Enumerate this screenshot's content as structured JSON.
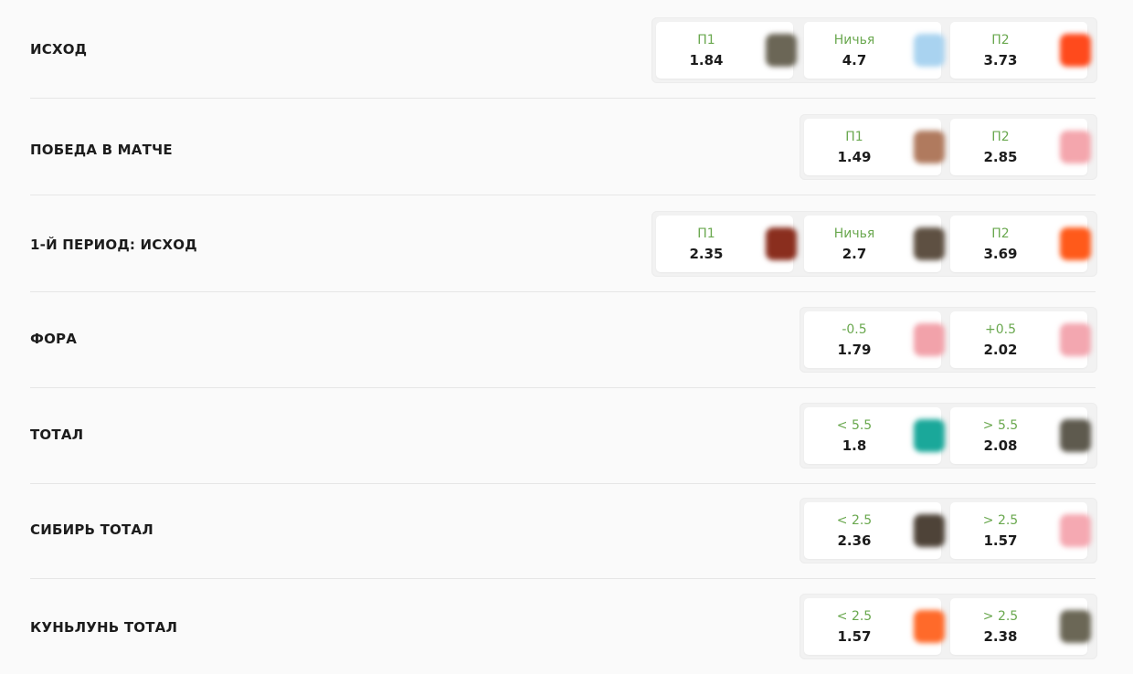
{
  "markets": [
    {
      "name": "ИСХОД",
      "odds": [
        {
          "label": "П1",
          "value": "1.84",
          "thumb_color": "#6b6656"
        },
        {
          "label": "Ничья",
          "value": "4.7",
          "thumb_color": "#a9d3f0"
        },
        {
          "label": "П2",
          "value": "3.73",
          "thumb_color": "#ff4a1c"
        }
      ]
    },
    {
      "name": "ПОБЕДА В МАТЧЕ",
      "odds": [
        {
          "label": "П1",
          "value": "1.49",
          "thumb_color": "#b07a5e"
        },
        {
          "label": "П2",
          "value": "2.85",
          "thumb_color": "#f4a6ad"
        }
      ]
    },
    {
      "name": "1-Й ПЕРИОД: ИСХОД",
      "odds": [
        {
          "label": "П1",
          "value": "2.35",
          "thumb_color": "#8a2e1e"
        },
        {
          "label": "Ничья",
          "value": "2.7",
          "thumb_color": "#5e5042"
        },
        {
          "label": "П2",
          "value": "3.69",
          "thumb_color": "#ff5a1a"
        }
      ]
    },
    {
      "name": "ФОРА",
      "odds": [
        {
          "label": "-0.5",
          "value": "1.79",
          "thumb_color": "#f2a2aa"
        },
        {
          "label": "+0.5",
          "value": "2.02",
          "thumb_color": "#f3a7b0"
        }
      ]
    },
    {
      "name": "ТОТАЛ",
      "odds": [
        {
          "label": "< 5.5",
          "value": "1.8",
          "thumb_color": "#1aa89a"
        },
        {
          "label": "> 5.5",
          "value": "2.08",
          "thumb_color": "#5e5a4e"
        }
      ]
    },
    {
      "name": "СИБИРЬ ТОТАЛ",
      "odds": [
        {
          "label": "< 2.5",
          "value": "2.36",
          "thumb_color": "#4e4338"
        },
        {
          "label": "> 2.5",
          "value": "1.57",
          "thumb_color": "#f5a9b2"
        }
      ]
    },
    {
      "name": "КУНЬЛУНЬ ТОТАЛ",
      "odds": [
        {
          "label": "< 2.5",
          "value": "1.57",
          "thumb_color": "#ff6a2a"
        },
        {
          "label": "> 2.5",
          "value": "2.38",
          "thumb_color": "#6b6756"
        }
      ]
    }
  ]
}
